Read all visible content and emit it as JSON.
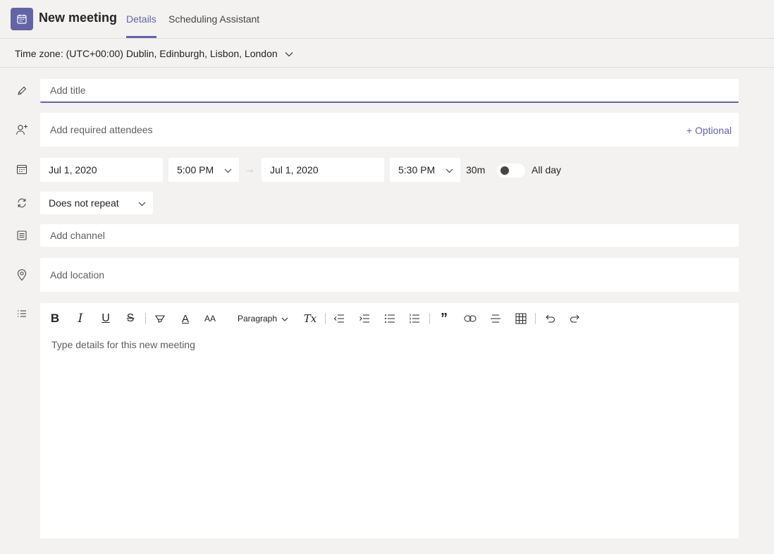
{
  "header": {
    "title": "New meeting",
    "tabs": [
      {
        "label": "Details",
        "active": true
      },
      {
        "label": "Scheduling Assistant",
        "active": false
      }
    ]
  },
  "timezone": {
    "label": "Time zone: (UTC+00:00) Dublin, Edinburgh, Lisbon, London"
  },
  "form": {
    "title_placeholder": "Add title",
    "attendees_placeholder": "Add required attendees",
    "optional_label": "+ Optional",
    "start_date": "Jul 1, 2020",
    "start_time": "5:00 PM",
    "end_date": "Jul 1, 2020",
    "end_time": "5:30 PM",
    "duration": "30m",
    "all_day_label": "All day",
    "all_day_on": false,
    "repeat": "Does not repeat",
    "channel_placeholder": "Add channel",
    "location_placeholder": "Add location",
    "details_placeholder": "Type details for this new meeting"
  },
  "toolbar": {
    "bold": "B",
    "italic": "I",
    "underline": "U",
    "strike": "S",
    "font_color": "A",
    "font_size": "AA",
    "paragraph": "Paragraph",
    "clear_format": "Tx"
  },
  "colors": {
    "accent": "#6264a7",
    "background": "#f3f2f1",
    "field": "#ffffff"
  }
}
